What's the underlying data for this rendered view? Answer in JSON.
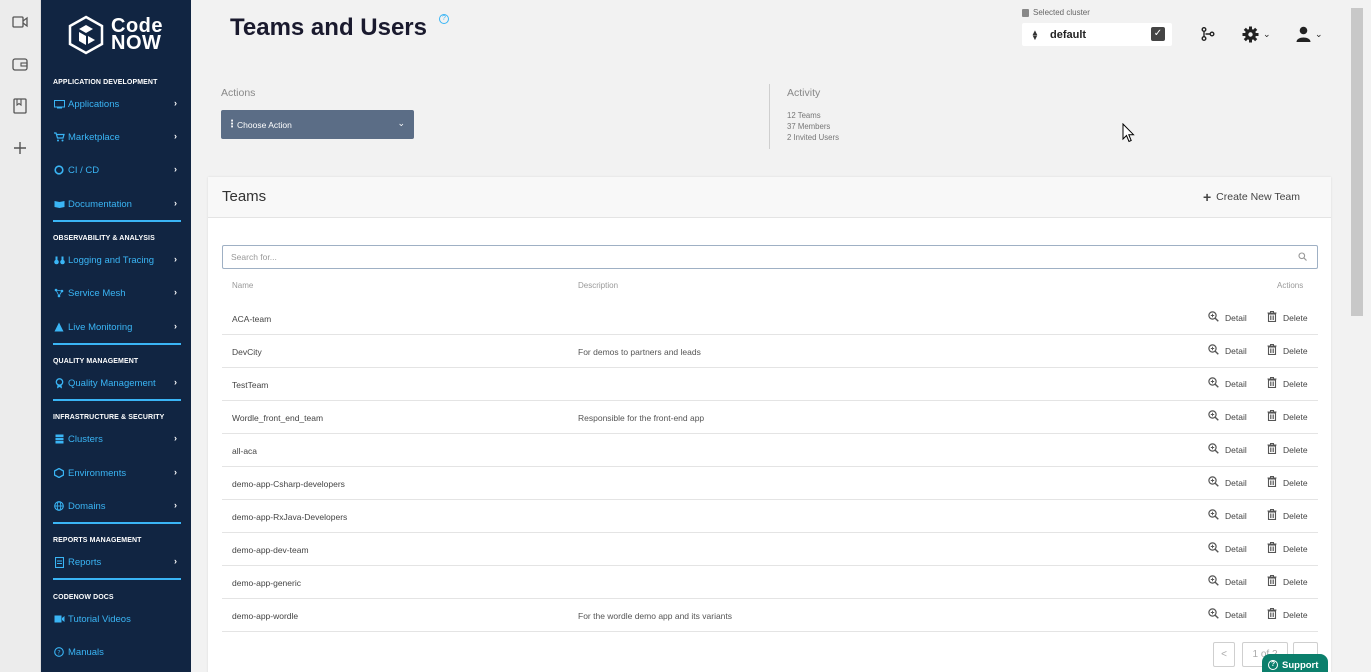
{
  "app": {
    "logo_top": "Code",
    "logo_bottom": "NOW",
    "page_title": "Teams and Users"
  },
  "sidebar": {
    "sections": [
      {
        "title": "APPLICATION DEVELOPMENT",
        "items": [
          {
            "label": "Applications",
            "icon": "apps-icon"
          },
          {
            "label": "Marketplace",
            "icon": "cart-icon"
          },
          {
            "label": "CI / CD",
            "icon": "cicd-icon"
          },
          {
            "label": "Documentation",
            "icon": "book-icon"
          }
        ]
      },
      {
        "title": "OBSERVABILITY & ANALYSIS",
        "items": [
          {
            "label": "Logging and Tracing",
            "icon": "binoculars-icon"
          },
          {
            "label": "Service Mesh",
            "icon": "mesh-icon"
          },
          {
            "label": "Live Monitoring",
            "icon": "monitor-icon"
          }
        ]
      },
      {
        "title": "QUALITY MANAGEMENT",
        "items": [
          {
            "label": "Quality Management",
            "icon": "quality-icon"
          }
        ]
      },
      {
        "title": "INFRASTRUCTURE & SECURITY",
        "items": [
          {
            "label": "Clusters",
            "icon": "clusters-icon"
          },
          {
            "label": "Environments",
            "icon": "env-icon"
          },
          {
            "label": "Domains",
            "icon": "globe-icon"
          }
        ]
      },
      {
        "title": "REPORTS MANAGEMENT",
        "items": [
          {
            "label": "Reports",
            "icon": "report-icon"
          }
        ]
      },
      {
        "title": "CODENOW DOCS",
        "items": [
          {
            "label": "Tutorial Videos",
            "icon": "video-icon"
          },
          {
            "label": "Manuals",
            "icon": "help-icon"
          }
        ]
      }
    ]
  },
  "header": {
    "cluster_label": "Selected cluster",
    "cluster_value": "default"
  },
  "actions": {
    "label": "Actions",
    "choose_label": "Choose Action"
  },
  "activity": {
    "label": "Activity",
    "teams": "12 Teams",
    "members": "37 Members",
    "invited": "2 Invited Users"
  },
  "teams": {
    "title": "Teams",
    "create_label": "Create New Team",
    "search_placeholder": "Search for...",
    "columns": {
      "name": "Name",
      "description": "Description",
      "actions": "Actions"
    },
    "detail_label": "Detail",
    "delete_label": "Delete",
    "rows": [
      {
        "name": "ACA-team",
        "description": ""
      },
      {
        "name": "DevCity",
        "description": "For demos to partners and leads"
      },
      {
        "name": "TestTeam",
        "description": ""
      },
      {
        "name": "Wordle_front_end_team",
        "description": "Responsible for the front-end app"
      },
      {
        "name": "all-aca",
        "description": ""
      },
      {
        "name": "demo-app-Csharp-developers",
        "description": ""
      },
      {
        "name": "demo-app-RxJava-Developers",
        "description": ""
      },
      {
        "name": "demo-app-dev-team",
        "description": ""
      },
      {
        "name": "demo-app-generic",
        "description": ""
      },
      {
        "name": "demo-app-wordle",
        "description": "For the wordle demo app and its variants"
      }
    ],
    "pagination": {
      "prev": "<",
      "page": "1 of 2"
    }
  },
  "support_label": "Support",
  "colors": {
    "sidebar": "#112542",
    "accent": "#3ab5f5",
    "action_button": "#5b6d86",
    "support": "#0b7f6c"
  }
}
